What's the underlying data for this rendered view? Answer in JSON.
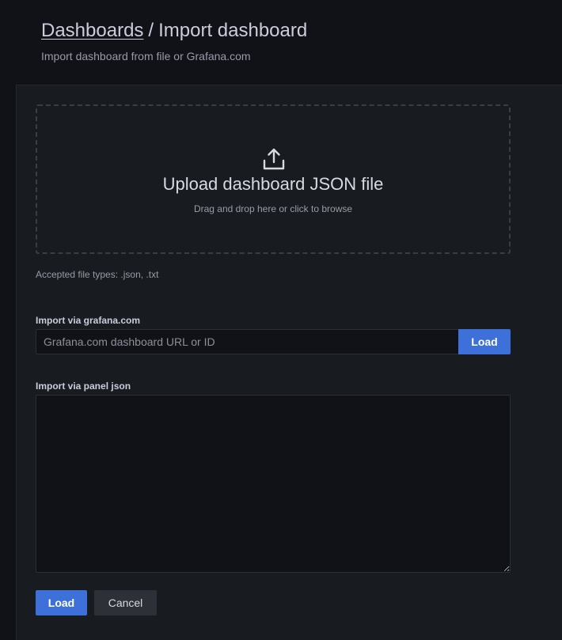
{
  "header": {
    "breadcrumb_link": "Dashboards",
    "breadcrumb_separator": "/",
    "title": "Import dashboard",
    "subtitle": "Import dashboard from file or Grafana.com"
  },
  "upload": {
    "icon": "upload-icon",
    "title": "Upload dashboard JSON file",
    "hint": "Drag and drop here or click to browse",
    "accepted_types": "Accepted file types: .json, .txt"
  },
  "grafana_import": {
    "label": "Import via grafana.com",
    "placeholder": "Grafana.com dashboard URL or ID",
    "value": "",
    "load_label": "Load"
  },
  "json_import": {
    "label": "Import via panel json",
    "value": ""
  },
  "actions": {
    "load_label": "Load",
    "cancel_label": "Cancel"
  },
  "colors": {
    "background": "#111217",
    "panel": "#181b1f",
    "primary_button": "#3d71d9",
    "secondary_button": "#2d3036"
  }
}
